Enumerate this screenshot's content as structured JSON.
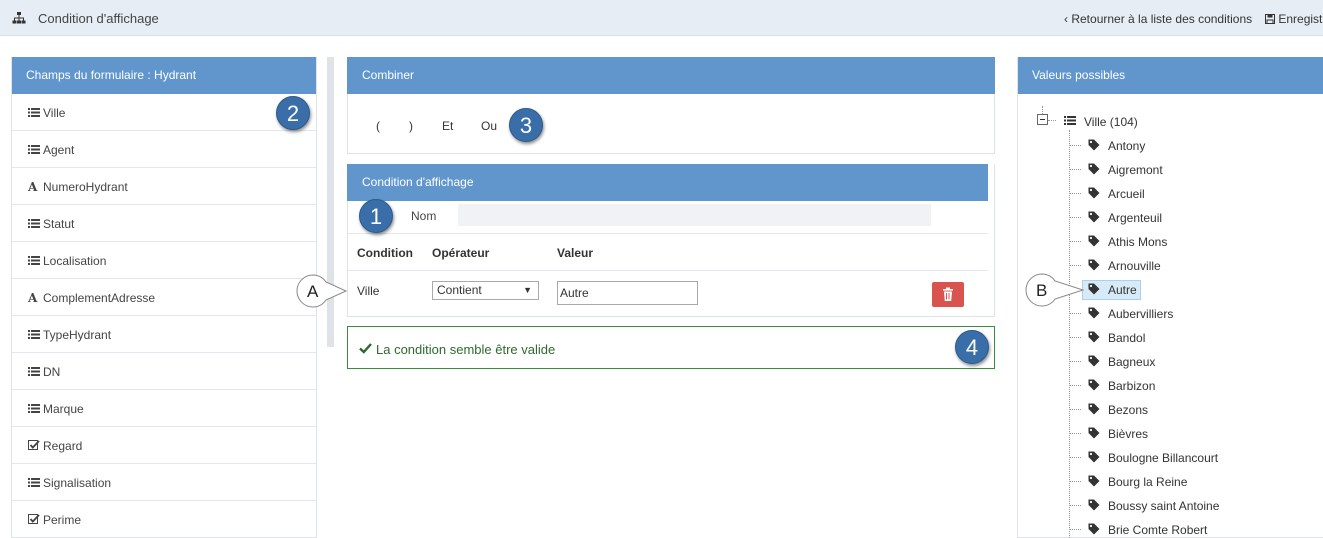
{
  "header": {
    "title": "Condition d'affichage",
    "back_label": "Retourner à la liste des conditions",
    "save_label": "Enregistr"
  },
  "fields_panel": {
    "title": "Champs du formulaire : Hydrant",
    "items": [
      {
        "label": "Ville",
        "icon": "list-icon"
      },
      {
        "label": "Agent",
        "icon": "list-icon"
      },
      {
        "label": "NumeroHydrant",
        "icon": "text-font-icon"
      },
      {
        "label": "Statut",
        "icon": "list-icon"
      },
      {
        "label": "Localisation",
        "icon": "list-icon"
      },
      {
        "label": "ComplementAdresse",
        "icon": "text-font-icon"
      },
      {
        "label": "TypeHydrant",
        "icon": "list-icon"
      },
      {
        "label": "DN",
        "icon": "list-icon"
      },
      {
        "label": "Marque",
        "icon": "list-icon"
      },
      {
        "label": "Regard",
        "icon": "checkbox-icon"
      },
      {
        "label": "Signalisation",
        "icon": "list-icon"
      },
      {
        "label": "Perime",
        "icon": "checkbox-icon"
      }
    ]
  },
  "combine_panel": {
    "title": "Combiner",
    "buttons": [
      "(",
      ")",
      "Et",
      "Ou"
    ]
  },
  "condition_panel": {
    "title": "Condition d'affichage",
    "nom_label": "Nom",
    "nom_value": "",
    "columns": [
      "Condition",
      "Opérateur",
      "Valeur"
    ],
    "row": {
      "condition": "Ville",
      "operator": "Contient",
      "value": "Autre"
    }
  },
  "validation": {
    "message": "La condition semble être valide",
    "status_color": "#2d6a2d"
  },
  "values_panel": {
    "title": "Valeurs possibles",
    "root_label": "Ville (104)",
    "items": [
      "Antony",
      "Aigremont",
      "Arcueil",
      "Argenteuil",
      "Athis Mons",
      "Arnouville",
      "Autre",
      "Aubervilliers",
      "Bandol",
      "Bagneux",
      "Barbizon",
      "Bezons",
      "Bièvres",
      "Boulogne Billancourt",
      "Bourg la Reine",
      "Boussy saint Antoine",
      "Brie Comte Robert"
    ],
    "selected": "Autre"
  },
  "callouts": {
    "one": "1",
    "two": "2",
    "three": "3",
    "four": "4",
    "a": "A",
    "b": "B"
  },
  "colors": {
    "header_blue": "#6196cd",
    "topbar_bg": "#e6edf5",
    "delete_red": "#d9534f",
    "badge_blue": "#3a6ea8"
  }
}
